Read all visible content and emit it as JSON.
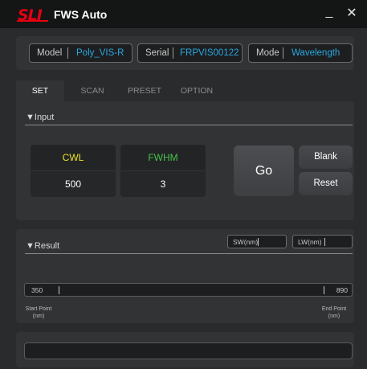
{
  "window": {
    "logo": "SLI",
    "title": "FWS Auto",
    "minimize_glyph": "_",
    "close_glyph": "✕"
  },
  "info": {
    "model_label": "Model",
    "model_value": "Poly_VIS-R",
    "serial_label": "Serial",
    "serial_value": "FRPVIS00122",
    "mode_label": "Mode",
    "mode_value": "Wavelength"
  },
  "tabs": [
    {
      "label": "SET",
      "active": true
    },
    {
      "label": "SCAN",
      "active": false
    },
    {
      "label": "PRESET",
      "active": false
    },
    {
      "label": "OPTION",
      "active": false
    }
  ],
  "input_section": {
    "title": "▼Input",
    "cwl_label": "CWL",
    "cwl_value": "500",
    "fwhm_label": "FWHM",
    "fwhm_value": "3",
    "go_label": "Go",
    "blank_label": "Blank",
    "reset_label": "Reset"
  },
  "result_section": {
    "title": "▼Result",
    "sw_placeholder": "SW(nm)",
    "lw_placeholder": "LW(nm)",
    "start_value": "350",
    "end_value": "890",
    "start_label_1": "Start Point",
    "start_label_2": "(nm)",
    "end_label_1": "End Point",
    "end_label_2": "(nm)"
  },
  "colors": {
    "brand_red": "#e60012",
    "value_blue": "#2aa7e0",
    "cwl_yellow": "#e8e22a",
    "fwhm_green": "#45c14a"
  }
}
